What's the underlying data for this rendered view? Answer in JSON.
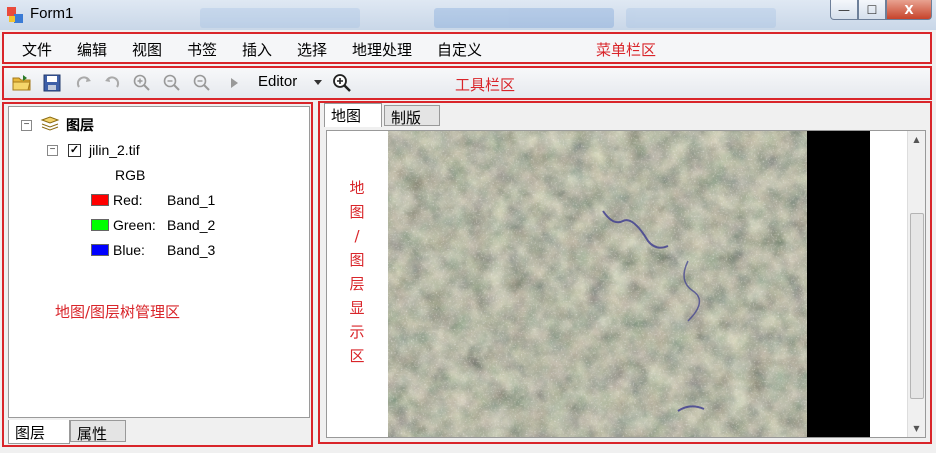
{
  "window": {
    "title": "Form1",
    "buttons": {
      "minimize": "—",
      "maximize": "☐",
      "close": "X"
    }
  },
  "menubar": {
    "items": [
      "文件",
      "编辑",
      "视图",
      "书签",
      "插入",
      "选择",
      "地理处理",
      "自定义"
    ],
    "region_label": "菜单栏区"
  },
  "toolbar": {
    "icons": [
      "open-folder-icon",
      "save-icon",
      "redo-icon",
      "undo-icon",
      "zoom-in-icon",
      "zoom-out-icon",
      "zoom-out-fixed-icon",
      "select-arrow-icon"
    ],
    "editor_label": "Editor",
    "region_label": "工具栏区"
  },
  "toc": {
    "root_label": "图层",
    "layer": {
      "name": "jilin_2.tif",
      "checked": true
    },
    "renderer": "RGB",
    "bands": [
      {
        "channel": "Red:",
        "band": "Band_1",
        "color": "#ff0000"
      },
      {
        "channel": "Green:",
        "band": "Band_2",
        "color": "#00ff00"
      },
      {
        "channel": "Blue:",
        "band": "Band_3",
        "color": "#0000ff"
      }
    ],
    "region_label": "地图/图层树管理区",
    "tabs": [
      "图层",
      "属性"
    ]
  },
  "map_panel": {
    "tabs": [
      "地图",
      "制版"
    ],
    "region_label_chars": [
      "地",
      "图",
      "/",
      "图",
      "层",
      "显",
      "示",
      "区"
    ]
  },
  "colors": {
    "annotation_red": "#d9252a",
    "nodata_black": "#000000"
  }
}
